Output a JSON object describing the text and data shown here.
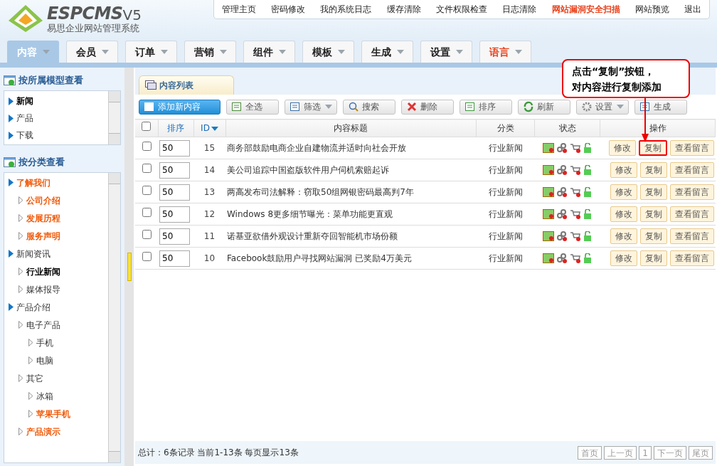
{
  "brand": {
    "name": "ESPCMS",
    "version": "V5",
    "subtitle": "易思企业网站管理系统"
  },
  "top_links": [
    {
      "label": "管理主页",
      "warning": false
    },
    {
      "label": "密码修改",
      "warning": false
    },
    {
      "label": "我的系统日志",
      "warning": false
    },
    {
      "label": "缓存清除",
      "warning": false
    },
    {
      "label": "文件权限检查",
      "warning": false
    },
    {
      "label": "日志清除",
      "warning": false
    },
    {
      "label": "网站漏洞安全扫描",
      "warning": true
    },
    {
      "label": "网站预览",
      "warning": false
    },
    {
      "label": "退出",
      "warning": false
    }
  ],
  "nav_tabs": [
    {
      "label": "内容",
      "selected": true,
      "warning": false
    },
    {
      "label": "会员",
      "selected": false,
      "warning": false
    },
    {
      "label": "订单",
      "selected": false,
      "warning": false
    },
    {
      "label": "营销",
      "selected": false,
      "warning": false
    },
    {
      "label": "组件",
      "selected": false,
      "warning": false
    },
    {
      "label": "模板",
      "selected": false,
      "warning": false
    },
    {
      "label": "生成",
      "selected": false,
      "warning": false
    },
    {
      "label": "设置",
      "selected": false,
      "warning": false
    },
    {
      "label": "语言",
      "selected": false,
      "warning": true
    }
  ],
  "sidebar": {
    "model_panel": {
      "title": "按所属模型查看",
      "items": [
        {
          "label": "新闻",
          "selected": true
        },
        {
          "label": "产品",
          "selected": false
        },
        {
          "label": "下载",
          "selected": false
        }
      ]
    },
    "category_panel": {
      "title": "按分类查看",
      "items": [
        {
          "label": "了解我们",
          "selected": false,
          "marked": true,
          "children": [
            {
              "label": "公司介绍",
              "selected": false,
              "marked": true
            },
            {
              "label": "发展历程",
              "selected": false,
              "marked": true
            },
            {
              "label": "服务声明",
              "selected": false,
              "marked": true
            }
          ]
        },
        {
          "label": "新闻资讯",
          "selected": false,
          "marked": false,
          "children": [
            {
              "label": "行业新闻",
              "selected": true,
              "marked": false
            },
            {
              "label": "媒体报导",
              "selected": false,
              "marked": false
            }
          ]
        },
        {
          "label": "产品介绍",
          "selected": false,
          "marked": false,
          "children": [
            {
              "label": "电子产品",
              "selected": false,
              "marked": false,
              "children": [
                {
                  "label": "手机",
                  "selected": false,
                  "marked": false
                },
                {
                  "label": "电脑",
                  "selected": false,
                  "marked": false
                }
              ]
            },
            {
              "label": "其它",
              "selected": false,
              "marked": false,
              "children": [
                {
                  "label": "冰箱",
                  "selected": false,
                  "marked": false
                },
                {
                  "label": "苹果手机",
                  "selected": false,
                  "marked": true
                }
              ]
            },
            {
              "label": "产品演示",
              "selected": false,
              "marked": true
            }
          ]
        }
      ]
    }
  },
  "content_tab": "内容列表",
  "toolbar": [
    {
      "label": "添加新内容",
      "kind": "primary"
    },
    {
      "label": "全选",
      "kind": "plain"
    },
    {
      "label": "筛选",
      "kind": "dropdown"
    },
    {
      "label": "搜索",
      "kind": "plain"
    },
    {
      "label": "删除",
      "kind": "plain"
    },
    {
      "label": "排序",
      "kind": "plain"
    },
    {
      "label": "刷新",
      "kind": "plain"
    },
    {
      "label": "设置",
      "kind": "dropdown"
    },
    {
      "label": "生成",
      "kind": "plain"
    }
  ],
  "table": {
    "columns": [
      "排序",
      "ID",
      "内容标题",
      "分类",
      "状态",
      "操作"
    ],
    "select_all_checked": false,
    "rows": [
      {
        "checked": false,
        "sort": "50",
        "id": "15",
        "title": "商务部鼓励电商企业自建物流并适时向社会开放",
        "category": "行业新闻",
        "actions": [
          {
            "label": "修改",
            "highlighted": false
          },
          {
            "label": "复制",
            "highlighted": true
          },
          {
            "label": "查看留言",
            "highlighted": false
          }
        ]
      },
      {
        "checked": false,
        "sort": "50",
        "id": "14",
        "title": "美公司追踪中国盗版软件用户伺机索赔起诉",
        "category": "行业新闻",
        "actions": [
          {
            "label": "修改",
            "highlighted": false
          },
          {
            "label": "复制",
            "highlighted": false
          },
          {
            "label": "查看留言",
            "highlighted": false
          }
        ]
      },
      {
        "checked": false,
        "sort": "50",
        "id": "13",
        "title": "两高发布司法解释：窃取50组网银密码最高判7年",
        "category": "行业新闻",
        "actions": [
          {
            "label": "修改",
            "highlighted": false
          },
          {
            "label": "复制",
            "highlighted": false
          },
          {
            "label": "查看留言",
            "highlighted": false
          }
        ]
      },
      {
        "checked": false,
        "sort": "50",
        "id": "12",
        "title": "Windows 8更多细节曝光：菜单功能更直观",
        "category": "行业新闻",
        "actions": [
          {
            "label": "修改",
            "highlighted": false
          },
          {
            "label": "复制",
            "highlighted": false
          },
          {
            "label": "查看留言",
            "highlighted": false
          }
        ]
      },
      {
        "checked": false,
        "sort": "50",
        "id": "11",
        "title": "诺基亚欲借外观设计重新夺回智能机市场份额",
        "category": "行业新闻",
        "actions": [
          {
            "label": "修改",
            "highlighted": false
          },
          {
            "label": "复制",
            "highlighted": false
          },
          {
            "label": "查看留言",
            "highlighted": false
          }
        ]
      },
      {
        "checked": false,
        "sort": "50",
        "id": "10",
        "title": "Facebook鼓励用户寻找网站漏洞 已奖励4万美元",
        "category": "行业新闻",
        "actions": [
          {
            "label": "修改",
            "highlighted": false
          },
          {
            "label": "复制",
            "highlighted": false
          },
          {
            "label": "查看留言",
            "highlighted": false
          }
        ]
      }
    ]
  },
  "footer": {
    "summary": "总计：6条记录 当前1-13条 每页显示13条",
    "pager": [
      "首页",
      "上一页",
      "1",
      "下一页",
      "尾页"
    ]
  },
  "callout": {
    "lines": [
      "点击“复制”按钮，",
      "对内容进行复制添加"
    ]
  }
}
